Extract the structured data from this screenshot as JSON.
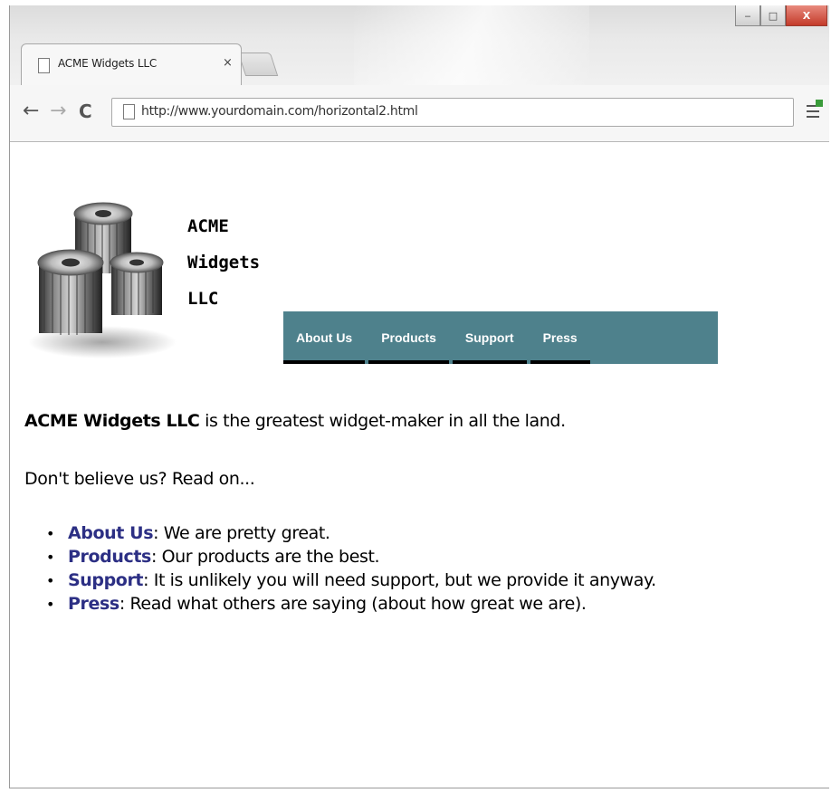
{
  "browser": {
    "tab_title": "ACME Widgets LLC",
    "tab_close": "×",
    "url": "http://www.yourdomain.com/horizontal2.html",
    "window_controls": {
      "minimize": "‒",
      "maximize": "□",
      "close": "X"
    }
  },
  "page": {
    "logo_icon": "gears-icon",
    "company_name": [
      "ACME",
      "Widgets",
      "LLC"
    ],
    "nav": [
      "About Us",
      "Products",
      "Support",
      "Press"
    ],
    "nav_color": "#4e818c",
    "intro": {
      "strong": "ACME Widgets LLC",
      "rest": " is the greatest widget-maker in all the land."
    },
    "teaser": "Don't believe us? Read on...",
    "features": [
      {
        "term": "About Us",
        "desc": ": We are pretty great."
      },
      {
        "term": "Products",
        "desc": ": Our products are the best."
      },
      {
        "term": "Support",
        "desc": ": It is unlikely you will need support, but we provide it anyway."
      },
      {
        "term": "Press",
        "desc": ": Read what others are saying (about how great we are)."
      }
    ],
    "link_color": "#2c2f84"
  }
}
